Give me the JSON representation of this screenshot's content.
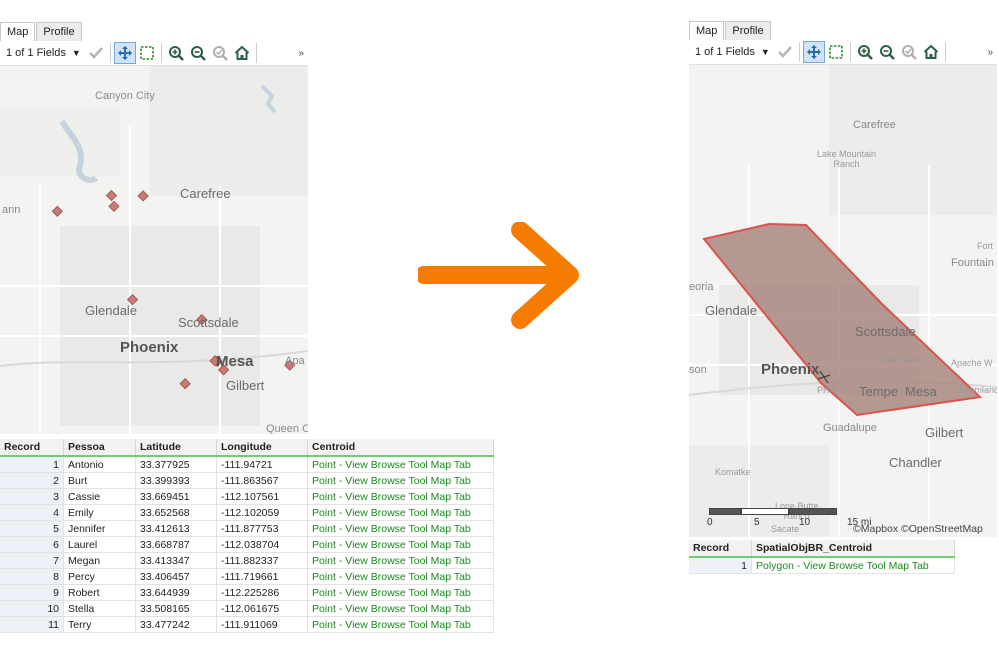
{
  "tabs": {
    "map": "Map",
    "profile": "Profile"
  },
  "toolbar": {
    "fields_label": "1 of 1 Fields",
    "more": "»"
  },
  "left_map": {
    "places": {
      "canyon_city": "Canyon City",
      "carefree": "Carefree",
      "glendale": "Glendale",
      "scottsdale": "Scottsdale",
      "phoenix": "Phoenix",
      "mesa": "Mesa",
      "gilbert": "Gilbert",
      "apa": "Apa",
      "queen": "Queen C",
      "ann": "ann"
    }
  },
  "left_table": {
    "headers": [
      "Record",
      "Pessoa",
      "Latitude",
      "Longitude",
      "Centroid"
    ],
    "rows": [
      [
        "1",
        "Antonio",
        "33.377925",
        "-111.94721",
        "Point - View Browse Tool Map Tab"
      ],
      [
        "2",
        "Burt",
        "33.399393",
        "-111.863567",
        "Point - View Browse Tool Map Tab"
      ],
      [
        "3",
        "Cassie",
        "33.669451",
        "-112.107561",
        "Point - View Browse Tool Map Tab"
      ],
      [
        "4",
        "Emily",
        "33.652568",
        "-112.102059",
        "Point - View Browse Tool Map Tab"
      ],
      [
        "5",
        "Jennifer",
        "33.412613",
        "-111.877753",
        "Point - View Browse Tool Map Tab"
      ],
      [
        "6",
        "Laurel",
        "33.668787",
        "-112.038704",
        "Point - View Browse Tool Map Tab"
      ],
      [
        "7",
        "Megan",
        "33.413347",
        "-111.882337",
        "Point - View Browse Tool Map Tab"
      ],
      [
        "8",
        "Percy",
        "33.406457",
        "-111.719661",
        "Point - View Browse Tool Map Tab"
      ],
      [
        "9",
        "Robert",
        "33.644939",
        "-112.225286",
        "Point - View Browse Tool Map Tab"
      ],
      [
        "10",
        "Stella",
        "33.508165",
        "-112.061675",
        "Point - View Browse Tool Map Tab"
      ],
      [
        "11",
        "Terry",
        "33.477242",
        "-111.911069",
        "Point - View Browse Tool Map Tab"
      ]
    ]
  },
  "right_map": {
    "places": {
      "carefree": "Carefree",
      "lake_mountain_ranch": "Lake Mountain\nRanch",
      "fort": "Fort",
      "fountain_hi": "Fountain Hi",
      "peoria": "eoria",
      "glendale": "Glendale",
      "scottsdale": "Scottsdale",
      "salt_river": "Salt River",
      "apache_w": "Apache W",
      "dreamland": "Dreamland",
      "son": "son",
      "phoenix": "Phoenix",
      "phx": "PHX",
      "tempe": "Tempe",
      "mesa": "Mesa",
      "guadalupe": "Guadalupe",
      "gilbert": "Gilbert",
      "chandler": "Chandler",
      "komatke": "Komatke",
      "lone_butte_ranch": "Lone Butte\nRanch",
      "sacate": "Sacate"
    },
    "scale": {
      "l0": "0",
      "l5": "5",
      "l10": "10",
      "l15": "15 mi"
    },
    "attribution": "©Mapbox ©OpenStreetMap"
  },
  "right_table": {
    "headers": [
      "Record",
      "SpatialObjBR_Centroid"
    ],
    "rows": [
      [
        "1",
        "Polygon - View Browse Tool Map Tab"
      ]
    ]
  },
  "colors": {
    "arrow": "#f57c00",
    "point_fill": "#c97b76",
    "polygon_fill": "#a9877f",
    "polygon_stroke": "#d9534f",
    "link_green": "#1a8a1a",
    "header_underline": "#6fcf6f"
  }
}
